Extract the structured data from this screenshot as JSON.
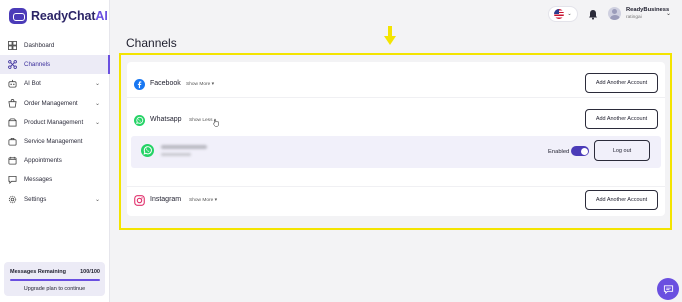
{
  "brand": {
    "name": "ReadyChat",
    "suffix": "AI",
    "accent": "#6a4fe0",
    "dark": "#2b2466"
  },
  "sidebar": {
    "items": [
      {
        "label": "Dashboard",
        "icon": "dashboard-icon",
        "has_chevron": false,
        "active": false
      },
      {
        "label": "Channels",
        "icon": "channels-icon",
        "has_chevron": false,
        "active": true
      },
      {
        "label": "AI Bot",
        "icon": "bot-icon",
        "has_chevron": true,
        "active": false
      },
      {
        "label": "Order Management",
        "icon": "order-icon",
        "has_chevron": true,
        "active": false
      },
      {
        "label": "Product Management",
        "icon": "product-icon",
        "has_chevron": true,
        "active": false
      },
      {
        "label": "Service Management",
        "icon": "service-icon",
        "has_chevron": false,
        "active": false
      },
      {
        "label": "Appointments",
        "icon": "calendar-icon",
        "has_chevron": false,
        "active": false
      },
      {
        "label": "Messages",
        "icon": "messages-icon",
        "has_chevron": false,
        "active": false
      },
      {
        "label": "Settings",
        "icon": "settings-icon",
        "has_chevron": true,
        "active": false
      }
    ],
    "messages_box": {
      "label": "Messages Remaining",
      "count": "100/100",
      "usage_fraction": 1.0,
      "upgrade_text": "Upgrade plan to continue"
    }
  },
  "topbar": {
    "language_flag": "us-flag-icon",
    "user": {
      "name": "ReadyBusiness",
      "role": "ratingai"
    }
  },
  "page": {
    "title": "Channels",
    "highlight_color": "#f3e400"
  },
  "channels": {
    "facebook": {
      "name": "Facebook",
      "toggle": "Show More ▾",
      "add_label": "Add Another Account",
      "color": "#1877f2"
    },
    "whatsapp": {
      "name": "Whatsapp",
      "toggle": "Show Less ▴",
      "add_label": "Add Another Account",
      "color": "#25d366",
      "account": {
        "status_label": "Enabled",
        "enabled": true,
        "logout_label": "Log out"
      }
    },
    "instagram": {
      "name": "Instagram",
      "toggle": "Show More ▾",
      "add_label": "Add Another Account",
      "color": "#e1306c"
    }
  }
}
